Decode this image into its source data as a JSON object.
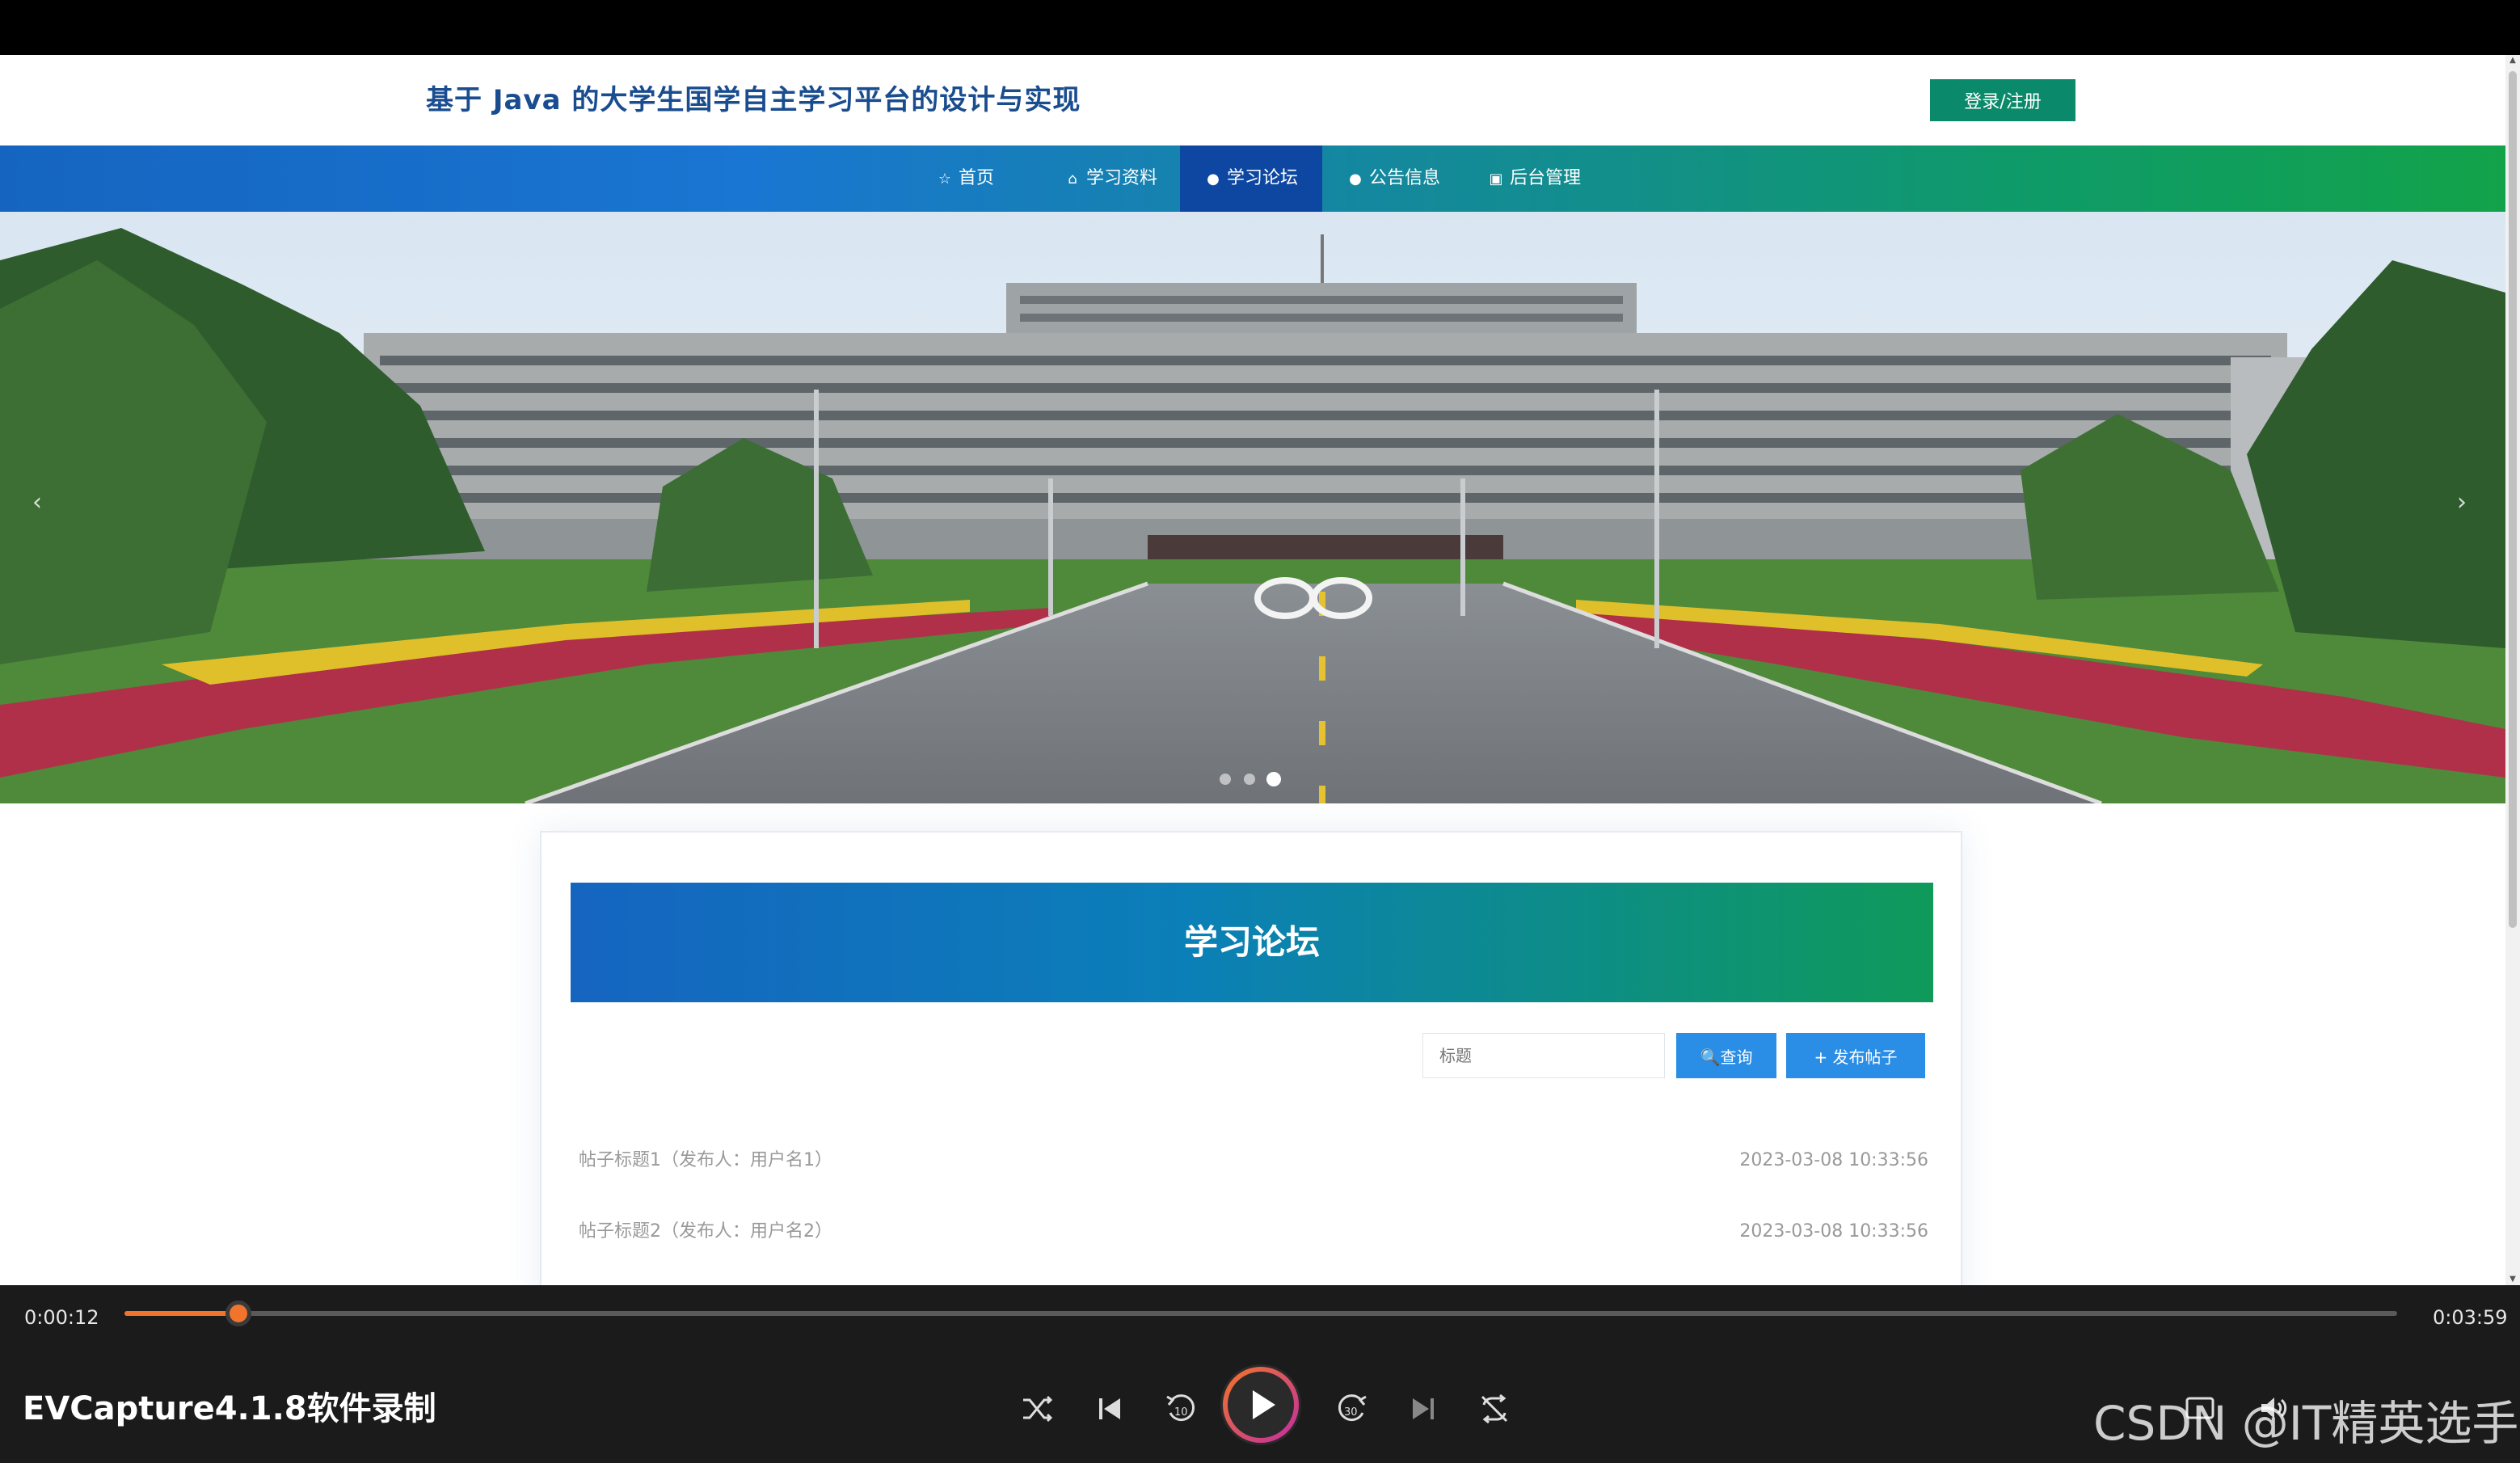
{
  "site": {
    "title": "基于 Java 的大学生国学自主学习平台的设计与实现",
    "login_label": "登录/注册"
  },
  "nav": {
    "items": [
      {
        "label": "首页",
        "icon": "star-icon"
      },
      {
        "label": "学习资料",
        "icon": "home-icon"
      },
      {
        "label": "学习论坛",
        "icon": "circle-icon"
      },
      {
        "label": "公告信息",
        "icon": "circle-icon"
      },
      {
        "label": "后台管理",
        "icon": "calendar-icon"
      }
    ],
    "active_index": 2
  },
  "carousel": {
    "prev": "‹",
    "next": "›",
    "slide_count": 3,
    "active_slide": 3
  },
  "forum": {
    "title": "学习论坛",
    "search_placeholder": "标题",
    "search_label": "🔍查询",
    "post_label": "+ 发布帖子",
    "posts": [
      {
        "title": "帖子标题1（发布人：用户名1）",
        "date": "2023-03-08 10:33:56"
      },
      {
        "title": "帖子标题2（发布人：用户名2）",
        "date": "2023-03-08 10:33:56"
      }
    ]
  },
  "player": {
    "current_time": "0:00:12",
    "total_time": "0:03:59",
    "progress": 0.05,
    "recorder_label": "EVCapture4.1.8软件录制",
    "watermark": "CSDN @IT精英选手",
    "accent_color": "#f0742c"
  },
  "colors": {
    "nav_start": "#1565c0",
    "nav_end": "#12a34a",
    "title": "#1a4d8f",
    "login_button": "#0a8a6a",
    "search_button": "#2a8de6"
  }
}
